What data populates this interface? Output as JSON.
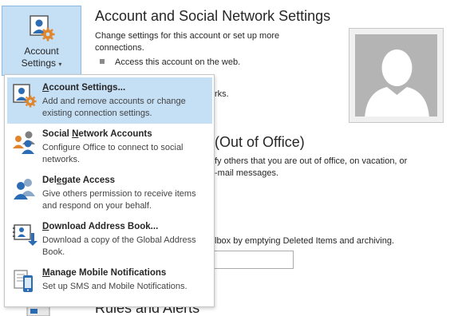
{
  "account_button": {
    "line1": "Account",
    "line2": "Settings",
    "caret": "▾",
    "icon": "account-settings-icon"
  },
  "section": {
    "title": "Account and Social Network Settings",
    "description": "Change settings for this account or set up more connections.",
    "bullet_web": "Access this account on the web.",
    "bullet_social_fragment": "rks.",
    "photo_icon": "person-silhouette-icon"
  },
  "auto_reply": {
    "heading_fragment": "(Out of Office)",
    "desc_line1": "fy others that you are out of office, on vacation, or",
    "desc_line2": "-mail messages."
  },
  "cleanup": {
    "desc_fragment": "lbox by emptying Deleted Items and archiving."
  },
  "rules": {
    "heading": "Rules and Alerts"
  },
  "menu": {
    "items": [
      {
        "title_pre": "",
        "title_key": "A",
        "title_post": "ccount Settings...",
        "desc": "Add and remove accounts or change existing connection settings.",
        "icon": "account-settings-icon",
        "active": true
      },
      {
        "title_pre": "Social ",
        "title_key": "N",
        "title_post": "etwork Accounts",
        "desc": "Configure Office to connect to social networks.",
        "icon": "social-network-icon",
        "active": false
      },
      {
        "title_pre": "Del",
        "title_key": "e",
        "title_post": "gate Access",
        "desc": "Give others permission to receive items and respond on your behalf.",
        "icon": "delegate-people-icon",
        "active": false
      },
      {
        "title_pre": "",
        "title_key": "D",
        "title_post": "ownload Address Book...",
        "desc": "Download a copy of the Global Address Book.",
        "icon": "address-book-download-icon",
        "active": false
      },
      {
        "title_pre": "",
        "title_key": "M",
        "title_post": "anage Mobile Notifications",
        "desc": "Set up SMS and Mobile Notifications.",
        "icon": "mobile-phone-icon",
        "active": false
      }
    ]
  },
  "colors": {
    "highlight": "#c5dff5",
    "accent_orange": "#e0852b",
    "accent_blue": "#2b6cb5"
  }
}
